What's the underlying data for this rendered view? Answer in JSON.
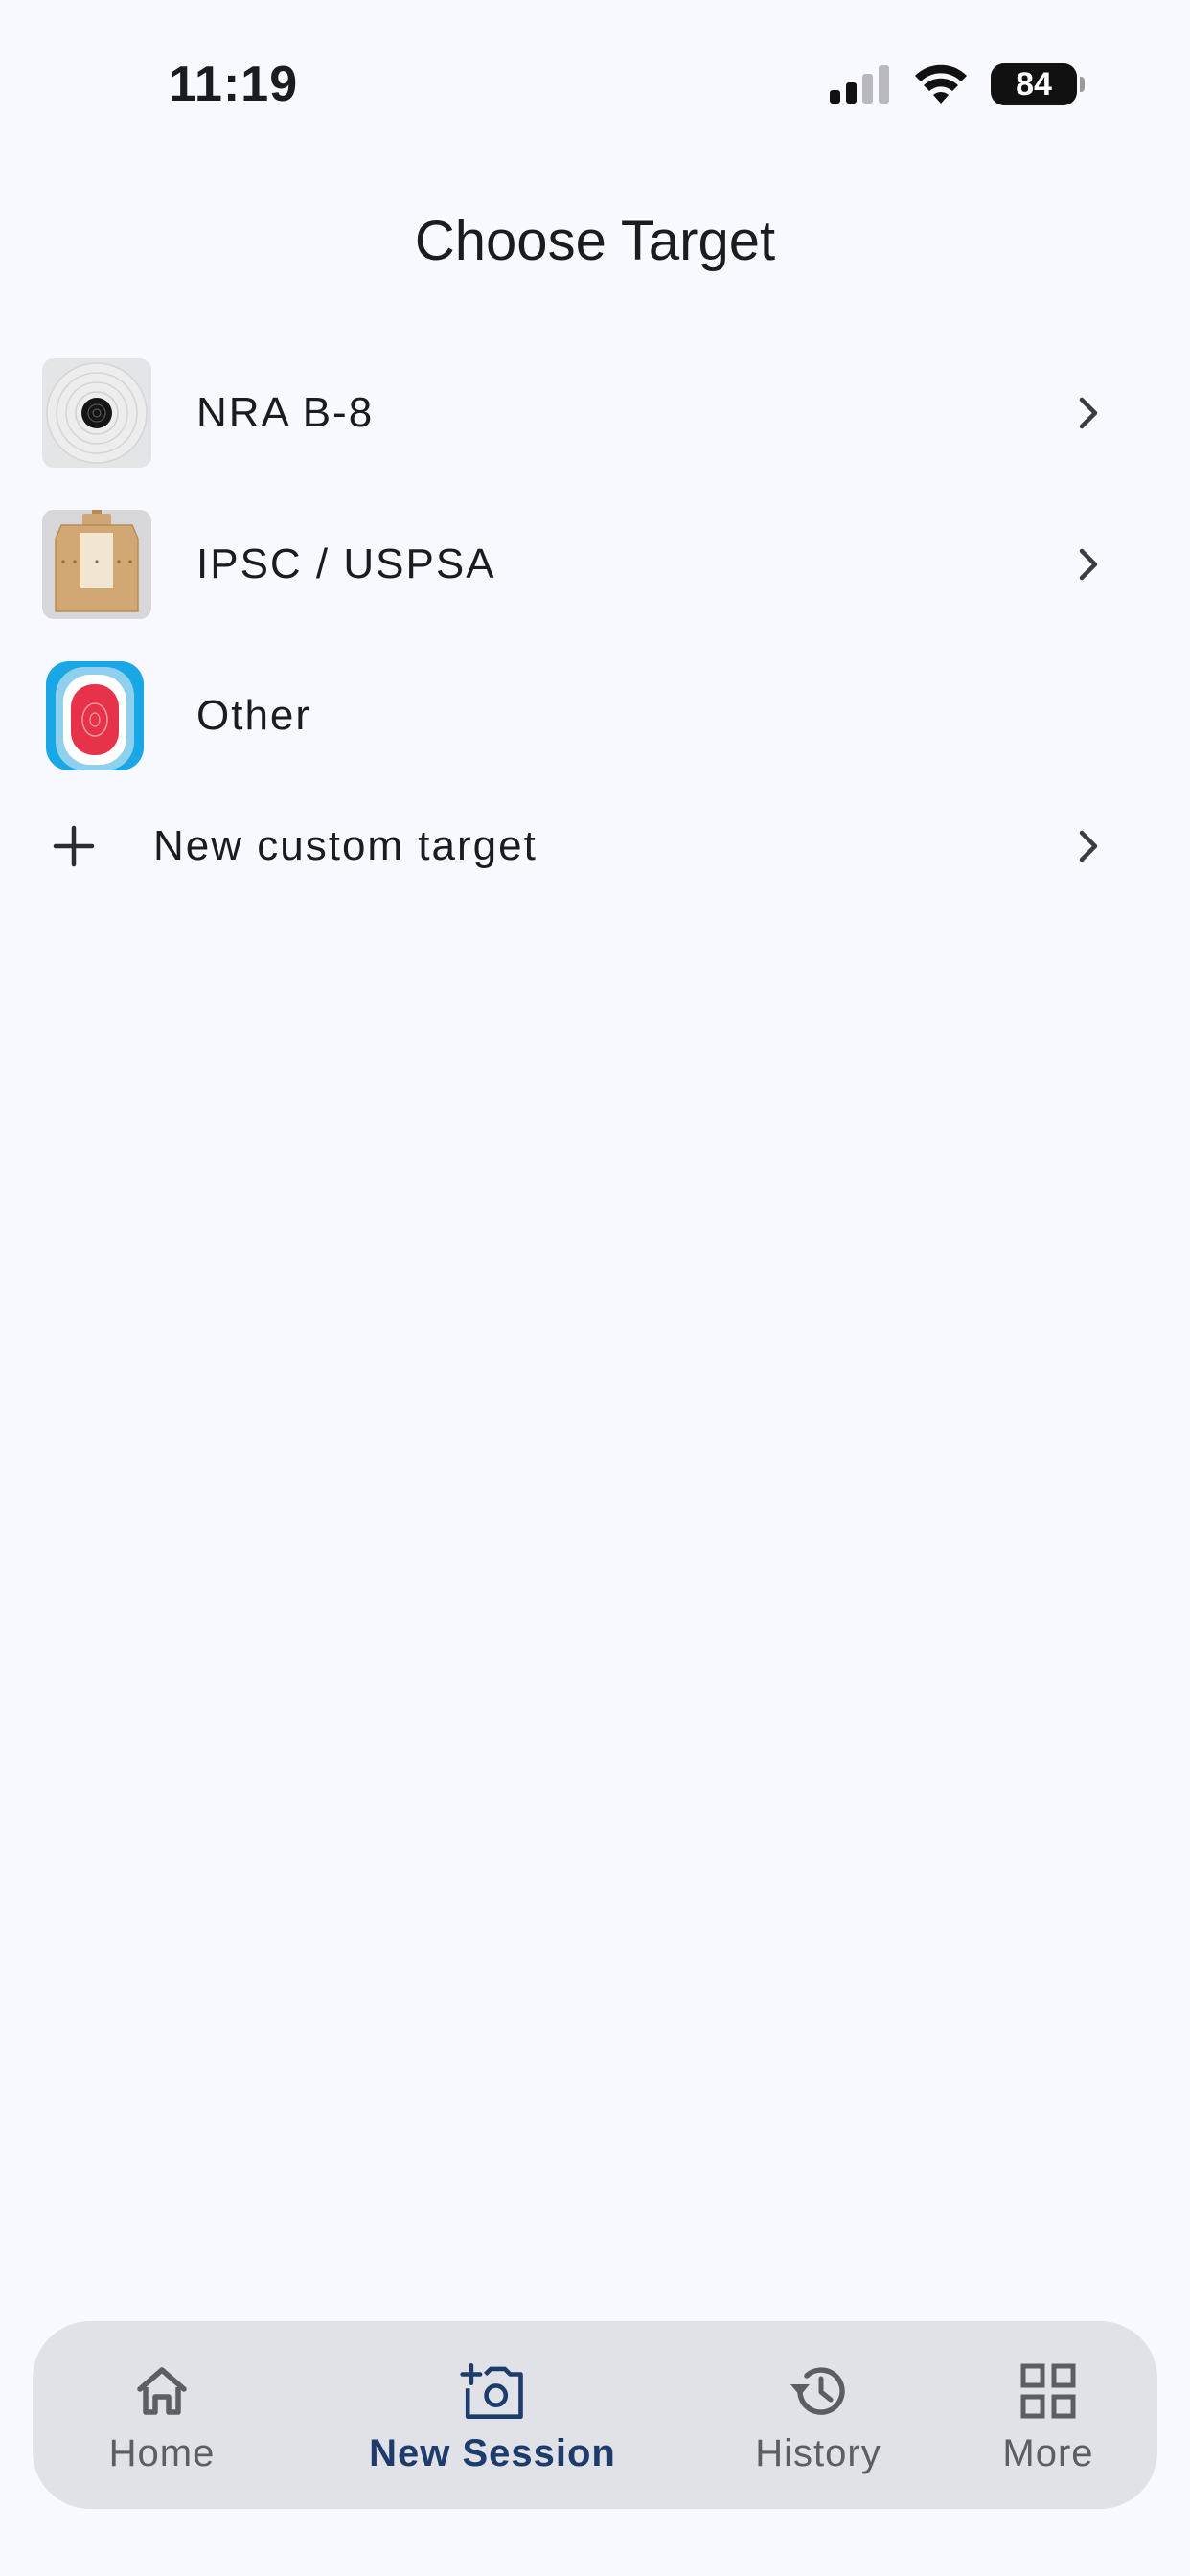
{
  "status_bar": {
    "time": "11:19",
    "battery": "84",
    "icons": [
      "signal-icon",
      "wifi-icon",
      "battery-icon"
    ]
  },
  "page": {
    "title": "Choose Target"
  },
  "targets": [
    {
      "label": "NRA B-8",
      "icon": "nra-b8-target-thumbnail",
      "has_chevron": true
    },
    {
      "label": "IPSC / USPSA",
      "icon": "ipsc-uspsa-target-thumbnail",
      "has_chevron": true
    },
    {
      "label": "Other",
      "icon": "other-target-thumbnail",
      "has_chevron": false
    }
  ],
  "custom_target": {
    "label": "New custom target",
    "icon": "plus-icon"
  },
  "tabbar": {
    "tabs": [
      {
        "label": "Home",
        "icon": "home-icon",
        "active": false
      },
      {
        "label": "New Session",
        "icon": "add-camera-icon",
        "active": true
      },
      {
        "label": "History",
        "icon": "history-icon",
        "active": false
      },
      {
        "label": "More",
        "icon": "grid-icon",
        "active": false
      }
    ]
  },
  "colors": {
    "background": "#f7f9fe",
    "tabbar_background": "#e1e2e7",
    "active_tab": "#1d3c6b",
    "inactive_tab": "#5c5e63",
    "text": "#1b1c1f"
  }
}
